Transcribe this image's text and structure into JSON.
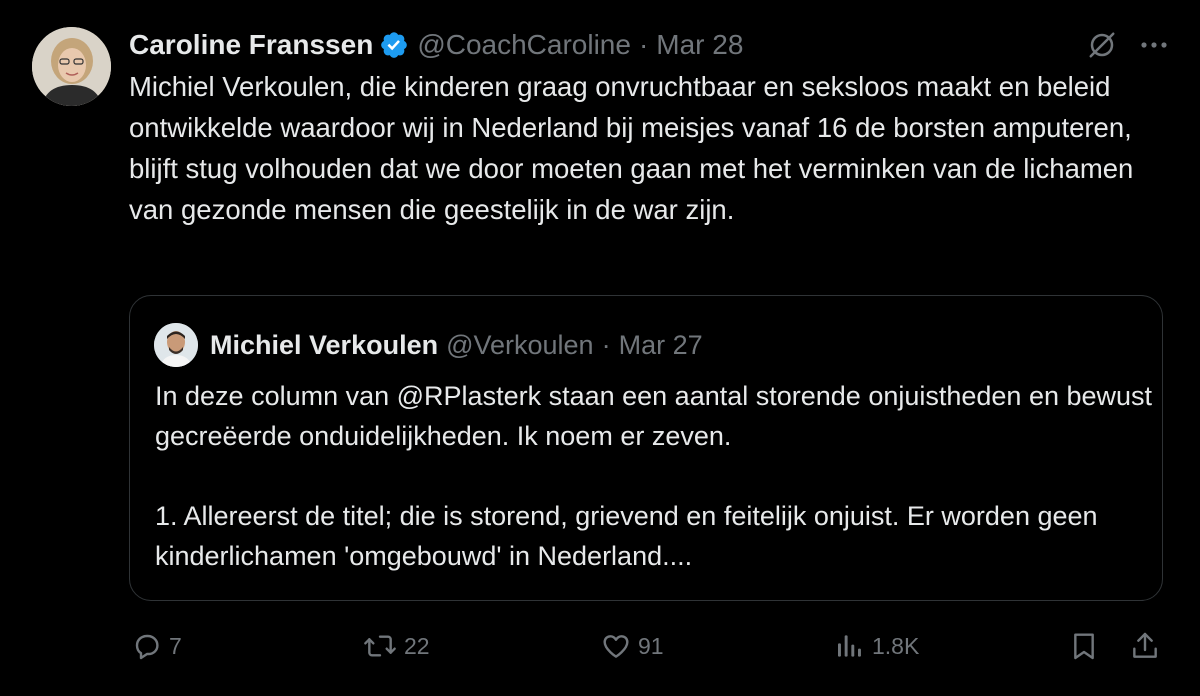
{
  "tweet": {
    "author_name": "Caroline Franssen",
    "handle": "@CoachCaroline",
    "separator": "·",
    "date": "Mar 28",
    "text": "Michiel Verkoulen, die kinderen graag onvruchtbaar en seksloos maakt en beleid ontwikkelde waardoor wij in Nederland bij meisjes vanaf 16 de borsten amputeren, blijft stug volhouden dat we door moeten gaan met het verminken van de lichamen van gezonde mensen die geestelijk in de war zijn.",
    "verified_color": "#1d9bf0",
    "icons": {
      "grok": "grok-icon",
      "more": "more-options-icon"
    }
  },
  "quote": {
    "author_name": "Michiel Verkoulen",
    "handle": "@Verkoulen",
    "separator": "·",
    "date": "Mar 27",
    "paragraph1": "In deze column van @RPlasterk staan een aantal storende onjuistheden en bewust gecreëerde onduidelijkheden. Ik noem er zeven.",
    "paragraph2": "1. Allereerst de titel; die is storend, grievend en feitelijk onjuist. Er worden geen kinderlichamen 'omgebouwd' in Nederland...."
  },
  "actions": {
    "replies": "7",
    "reposts": "22",
    "likes": "91",
    "views": "1.8K",
    "icons": [
      "reply-icon",
      "repost-icon",
      "like-icon",
      "views-icon",
      "bookmark-icon",
      "share-icon"
    ]
  },
  "colors": {
    "background": "#000000",
    "text": "#e7e9ea",
    "muted": "#71767b",
    "border": "#2f3336"
  }
}
